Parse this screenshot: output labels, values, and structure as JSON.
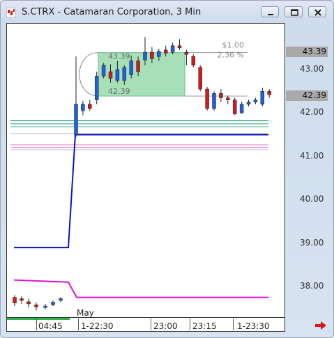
{
  "window": {
    "title": "S.CTRX - Catamaran Corporation, 3 Min",
    "minimize_icon": "minimize-icon",
    "restore_icon": "restore-icon",
    "close_icon": "close-icon"
  },
  "y_axis": {
    "ticks": [
      "43.00",
      "42.00",
      "41.00",
      "40.00",
      "39.00",
      "38.00"
    ],
    "current_price_label": "42.39",
    "high_price_label": "43.39"
  },
  "x_axis": {
    "labels": [
      "04:45",
      "1-22:30",
      "23:00",
      "23:15",
      "1-23:30"
    ],
    "month_label": "May"
  },
  "measure_box": {
    "change_label": "$1.00",
    "percent_label": "2.36 %",
    "top_price_label": "43.39",
    "bottom_price_label": "42.39"
  },
  "colors": {
    "up_candle": "#1f5fe0",
    "down_candle": "#d01c1c",
    "blue_line": "#0a18b8",
    "magenta_line": "#e010d8",
    "measure_fill": "#9ddcb0",
    "plot_bg": "#ffffff"
  },
  "chart_data": {
    "type": "candlestick",
    "y_range": [
      37.5,
      44.0
    ],
    "candles_early": [
      {
        "o": 37.75,
        "c": 37.62,
        "h": 37.8,
        "l": 37.55
      },
      {
        "o": 37.72,
        "c": 37.68,
        "h": 37.78,
        "l": 37.6
      },
      {
        "o": 37.65,
        "c": 37.6,
        "h": 37.72,
        "l": 37.52
      },
      {
        "o": 37.58,
        "c": 37.53,
        "h": 37.63,
        "l": 37.45
      },
      {
        "o": 37.52,
        "c": 37.55,
        "h": 37.6,
        "l": 37.48
      },
      {
        "o": 37.58,
        "c": 37.64,
        "h": 37.68,
        "l": 37.55
      },
      {
        "o": 37.68,
        "c": 37.72,
        "h": 37.76,
        "l": 37.64
      }
    ],
    "candles_session": [
      {
        "o": 41.5,
        "c": 42.2,
        "h": 43.3,
        "l": 41.45
      },
      {
        "o": 42.05,
        "c": 42.2,
        "h": 42.28,
        "l": 41.95
      },
      {
        "o": 42.2,
        "c": 42.1,
        "h": 42.3,
        "l": 42.05
      },
      {
        "o": 42.3,
        "c": 42.85,
        "h": 42.95,
        "l": 42.2
      },
      {
        "o": 42.85,
        "c": 43.1,
        "h": 43.15,
        "l": 42.8
      },
      {
        "o": 42.95,
        "c": 42.8,
        "h": 43.12,
        "l": 42.7
      },
      {
        "o": 42.75,
        "c": 43.0,
        "h": 43.2,
        "l": 42.7
      },
      {
        "o": 42.75,
        "c": 43.05,
        "h": 43.1,
        "l": 42.65
      },
      {
        "o": 42.88,
        "c": 43.2,
        "h": 43.32,
        "l": 42.8
      },
      {
        "o": 43.2,
        "c": 42.95,
        "h": 43.3,
        "l": 42.85
      },
      {
        "o": 43.22,
        "c": 43.4,
        "h": 43.75,
        "l": 43.1
      },
      {
        "o": 43.4,
        "c": 43.25,
        "h": 43.52,
        "l": 43.15
      },
      {
        "o": 43.3,
        "c": 43.42,
        "h": 43.48,
        "l": 43.2
      },
      {
        "o": 43.45,
        "c": 43.38,
        "h": 43.55,
        "l": 43.3
      },
      {
        "o": 43.4,
        "c": 43.55,
        "h": 43.62,
        "l": 43.35
      },
      {
        "o": 43.55,
        "c": 43.5,
        "h": 43.7,
        "l": 43.45
      },
      {
        "o": 43.4,
        "c": 43.35,
        "h": 43.45,
        "l": 43.1
      },
      {
        "o": 43.3,
        "c": 43.1,
        "h": 43.35,
        "l": 43.05
      },
      {
        "o": 43.05,
        "c": 42.55,
        "h": 43.1,
        "l": 42.5
      },
      {
        "o": 42.55,
        "c": 42.1,
        "h": 42.6,
        "l": 42.05
      },
      {
        "o": 42.1,
        "c": 42.45,
        "h": 42.5,
        "l": 42.05
      },
      {
        "o": 42.45,
        "c": 42.35,
        "h": 42.55,
        "l": 42.25
      },
      {
        "o": 42.35,
        "c": 42.3,
        "h": 42.4,
        "l": 42.2
      },
      {
        "o": 42.3,
        "c": 41.98,
        "h": 42.35,
        "l": 41.95
      },
      {
        "o": 42.0,
        "c": 42.2,
        "h": 42.25,
        "l": 41.98
      },
      {
        "o": 42.2,
        "c": 42.25,
        "h": 42.3,
        "l": 42.15
      },
      {
        "o": 42.25,
        "c": 42.3,
        "h": 42.35,
        "l": 42.2
      },
      {
        "o": 42.2,
        "c": 42.5,
        "h": 42.58,
        "l": 42.15
      },
      {
        "o": 42.5,
        "c": 42.42,
        "h": 42.55,
        "l": 42.35
      }
    ],
    "blue_line": [
      [
        0,
        38.9
      ],
      [
        1,
        38.9
      ],
      [
        2,
        41.5
      ],
      [
        3,
        41.5
      ]
    ],
    "magenta_line": [
      [
        0,
        38.15
      ],
      [
        1,
        38.1
      ],
      [
        2,
        37.75
      ],
      [
        3,
        37.75
      ]
    ],
    "horizontal_levels": [
      {
        "value": 41.82,
        "color": "#1f9a7a"
      },
      {
        "value": 41.75,
        "color": "#1f9a7a"
      },
      {
        "value": 41.68,
        "color": "#1f9a7a"
      },
      {
        "value": 41.52,
        "color": "#b0b0b0"
      },
      {
        "value": 41.27,
        "color": "#e46ad7"
      },
      {
        "value": 41.2,
        "color": "#e46ad7"
      },
      {
        "value": 41.15,
        "color": "#c0a0c0"
      }
    ]
  }
}
